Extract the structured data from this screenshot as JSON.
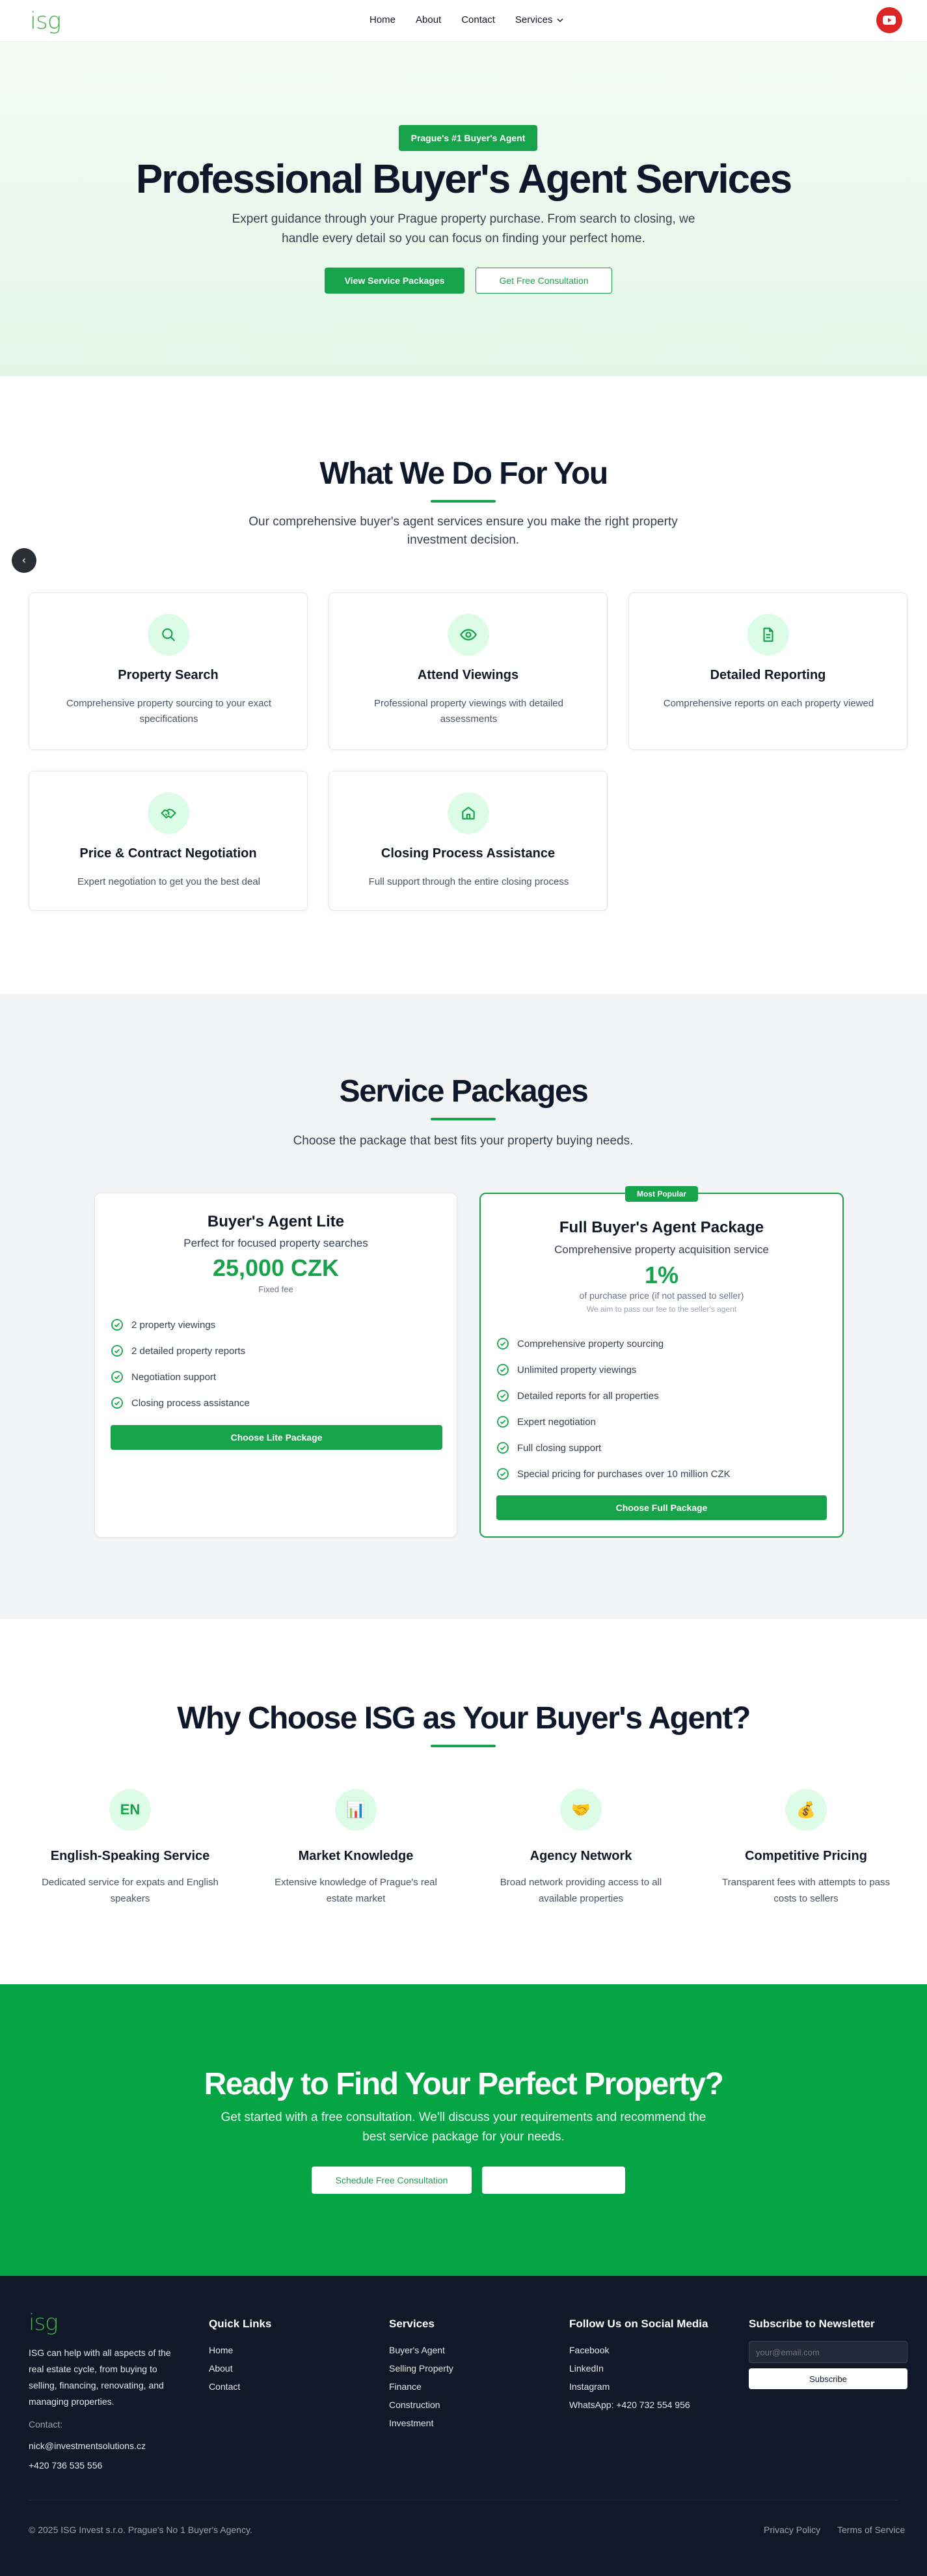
{
  "header": {
    "logo": "isg",
    "nav": [
      "Home",
      "About",
      "Contact",
      "Services"
    ]
  },
  "hero": {
    "badge": "Prague's #1 Buyer's Agent",
    "title": "Professional Buyer's Agent Services",
    "subtitle": "Expert guidance through your Prague property purchase. From search to closing, we handle every detail so you can focus on finding your perfect home.",
    "primary_button": "View Service Packages",
    "secondary_button": "Get Free Consultation"
  },
  "what": {
    "title": "What We Do For You",
    "subtitle": "Our comprehensive buyer's agent services ensure you make the right property investment decision.",
    "cards": [
      {
        "title": "Property Search",
        "text": "Comprehensive property sourcing to your exact specifications",
        "icon": "search-icon"
      },
      {
        "title": "Attend Viewings",
        "text": "Professional property viewings with detailed assessments",
        "icon": "eye-icon"
      },
      {
        "title": "Detailed Reporting",
        "text": "Comprehensive reports on each property viewed",
        "icon": "document-icon"
      },
      {
        "title": "Price & Contract Negotiation",
        "text": "Expert negotiation to get you the best deal",
        "icon": "handshake-icon"
      },
      {
        "title": "Closing Process Assistance",
        "text": "Full support through the entire closing process",
        "icon": "home-icon"
      }
    ]
  },
  "packages": {
    "title": "Service Packages",
    "subtitle": "Choose the package that best fits your property buying needs.",
    "lite": {
      "title": "Buyer's Agent Lite",
      "tagline": "Perfect for focused property searches",
      "price": "25,000 CZK",
      "price_note": "Fixed fee",
      "features": [
        "2 property viewings",
        "2 detailed property reports",
        "Negotiation support",
        "Closing process assistance"
      ],
      "button": "Choose Lite Package"
    },
    "full": {
      "ribbon": "Most Popular",
      "title": "Full Buyer's Agent Package",
      "tagline": "Comprehensive property acquisition service",
      "price": "1%",
      "price_note": "of purchase price (if not passed to seller)",
      "price_note2": "We aim to pass our fee to the seller's agent",
      "features": [
        "Comprehensive property sourcing",
        "Unlimited property viewings",
        "Detailed reports for all properties",
        "Expert negotiation",
        "Full closing support",
        "Special pricing for purchases over 10 million CZK"
      ],
      "button": "Choose Full Package"
    }
  },
  "why": {
    "title": "Why Choose ISG as Your Buyer's Agent?",
    "items": [
      {
        "icon_text": "EN",
        "title": "English-Speaking Service",
        "text": "Dedicated service for expats and English speakers"
      },
      {
        "icon_text": "📊",
        "title": "Market Knowledge",
        "text": "Extensive knowledge of Prague's real estate market"
      },
      {
        "icon_text": "🤝",
        "title": "Agency Network",
        "text": "Broad network providing access to all available properties"
      },
      {
        "icon_text": "💰",
        "title": "Competitive Pricing",
        "text": "Transparent fees with attempts to pass costs to sellers"
      }
    ]
  },
  "cta": {
    "title": "Ready to Find Your Perfect Property?",
    "subtitle": "Get started with a free consultation. We'll discuss your requirements and recommend the best service package for your needs.",
    "button": "Schedule Free Consultation",
    "button2": ""
  },
  "footer": {
    "logo": "isg",
    "about": "ISG can help with all aspects of the real estate cycle, from buying to selling, financing, renovating, and managing properties.",
    "contact_label": "Contact:",
    "email": "nick@investmentsolutions.cz",
    "phone": "+420 736 535 556",
    "quick_title": "Quick Links",
    "quick_links": [
      "Home",
      "About",
      "Contact"
    ],
    "services_title": "Services",
    "services": [
      "Buyer's Agent",
      "Selling Property",
      "Finance",
      "Construction",
      "Investment"
    ],
    "social_title": "Follow Us on Social Media",
    "social": [
      "Facebook",
      "LinkedIn",
      "Instagram",
      "WhatsApp: +420 732 554 956"
    ],
    "newsletter_title": "Subscribe to Newsletter",
    "newsletter_placeholder": "your@email.com",
    "newsletter_button": "Subscribe",
    "copyright": "© 2025 ISG Invest s.r.o. Prague's No 1 Buyer's Agency.",
    "privacy": "Privacy Policy",
    "terms": "Terms of Service"
  },
  "colors": {
    "accent": "#16a34a",
    "footer_bg": "#111827",
    "cta_bg": "#05a444",
    "youtube": "#dc2626"
  }
}
